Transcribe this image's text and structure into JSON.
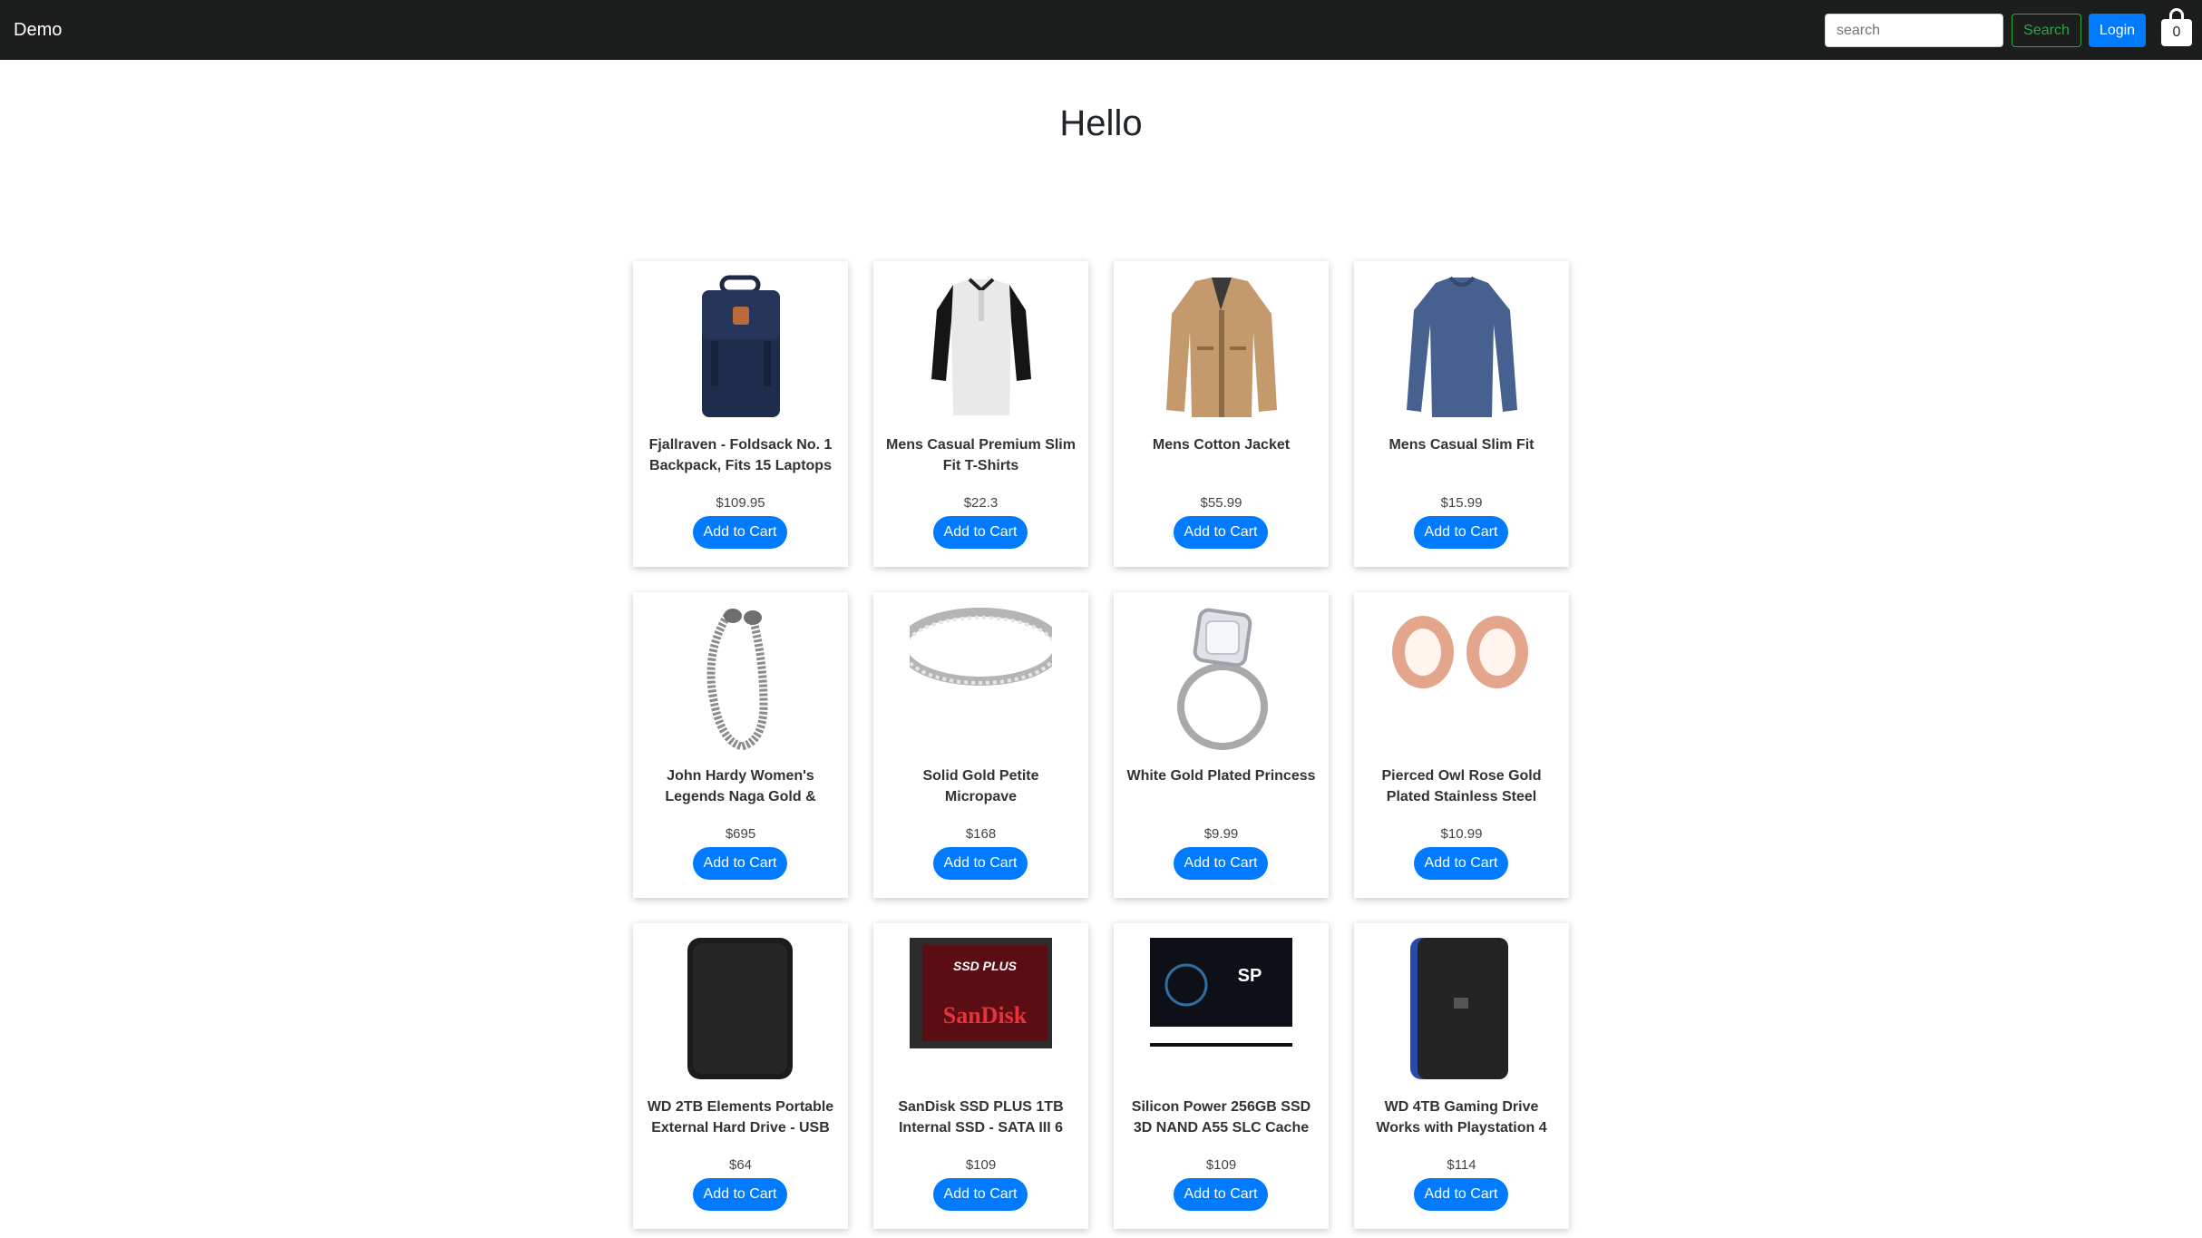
{
  "nav": {
    "brand": "Demo",
    "search_placeholder": "search",
    "search_label": "Search",
    "login_label": "Login",
    "cart_count": "0"
  },
  "main": {
    "heading": "Hello"
  },
  "colors": {
    "navbar_bg": "#1c1d1d",
    "primary": "#007bff",
    "success": "#28a745"
  },
  "products": [
    {
      "title": "Fjallraven - Foldsack No. 1 Backpack, Fits 15 Laptops",
      "price": "$109.95",
      "button": "Add to Cart",
      "icon": "backpack-image"
    },
    {
      "title": "Mens Casual Premium Slim Fit T-Shirts",
      "price": "$22.3",
      "button": "Add to Cart",
      "icon": "tshirt-image"
    },
    {
      "title": "Mens Cotton Jacket",
      "price": "$55.99",
      "button": "Add to Cart",
      "icon": "jacket-image"
    },
    {
      "title": "Mens Casual Slim Fit",
      "price": "$15.99",
      "button": "Add to Cart",
      "icon": "longsleeve-image"
    },
    {
      "title": "John Hardy Women's Legends Naga Gold &",
      "price": "$695",
      "button": "Add to Cart",
      "icon": "bracelet-image"
    },
    {
      "title": "Solid Gold Petite Micropave",
      "price": "$168",
      "button": "Add to Cart",
      "icon": "ring-band-image"
    },
    {
      "title": "White Gold Plated Princess",
      "price": "$9.99",
      "button": "Add to Cart",
      "icon": "diamond-ring-image"
    },
    {
      "title": "Pierced Owl Rose Gold Plated Stainless Steel",
      "price": "$10.99",
      "button": "Add to Cart",
      "icon": "ear-plugs-image"
    },
    {
      "title": "WD 2TB Elements Portable External Hard Drive - USB",
      "price": "$64",
      "button": "Add to Cart",
      "icon": "hard-drive-image"
    },
    {
      "title": "SanDisk SSD PLUS 1TB Internal SSD - SATA III 6",
      "price": "$109",
      "button": "Add to Cart",
      "icon": "sandisk-ssd-image",
      "label_top": "SSD PLUS",
      "label_brand": "SanDisk"
    },
    {
      "title": "Silicon Power 256GB SSD 3D NAND A55 SLC Cache",
      "price": "$109",
      "button": "Add to Cart",
      "icon": "silicon-power-ssd-image",
      "label_brand": "SP"
    },
    {
      "title": "WD 4TB Gaming Drive Works with Playstation 4",
      "price": "$114",
      "button": "Add to Cart",
      "icon": "gaming-drive-image"
    }
  ]
}
